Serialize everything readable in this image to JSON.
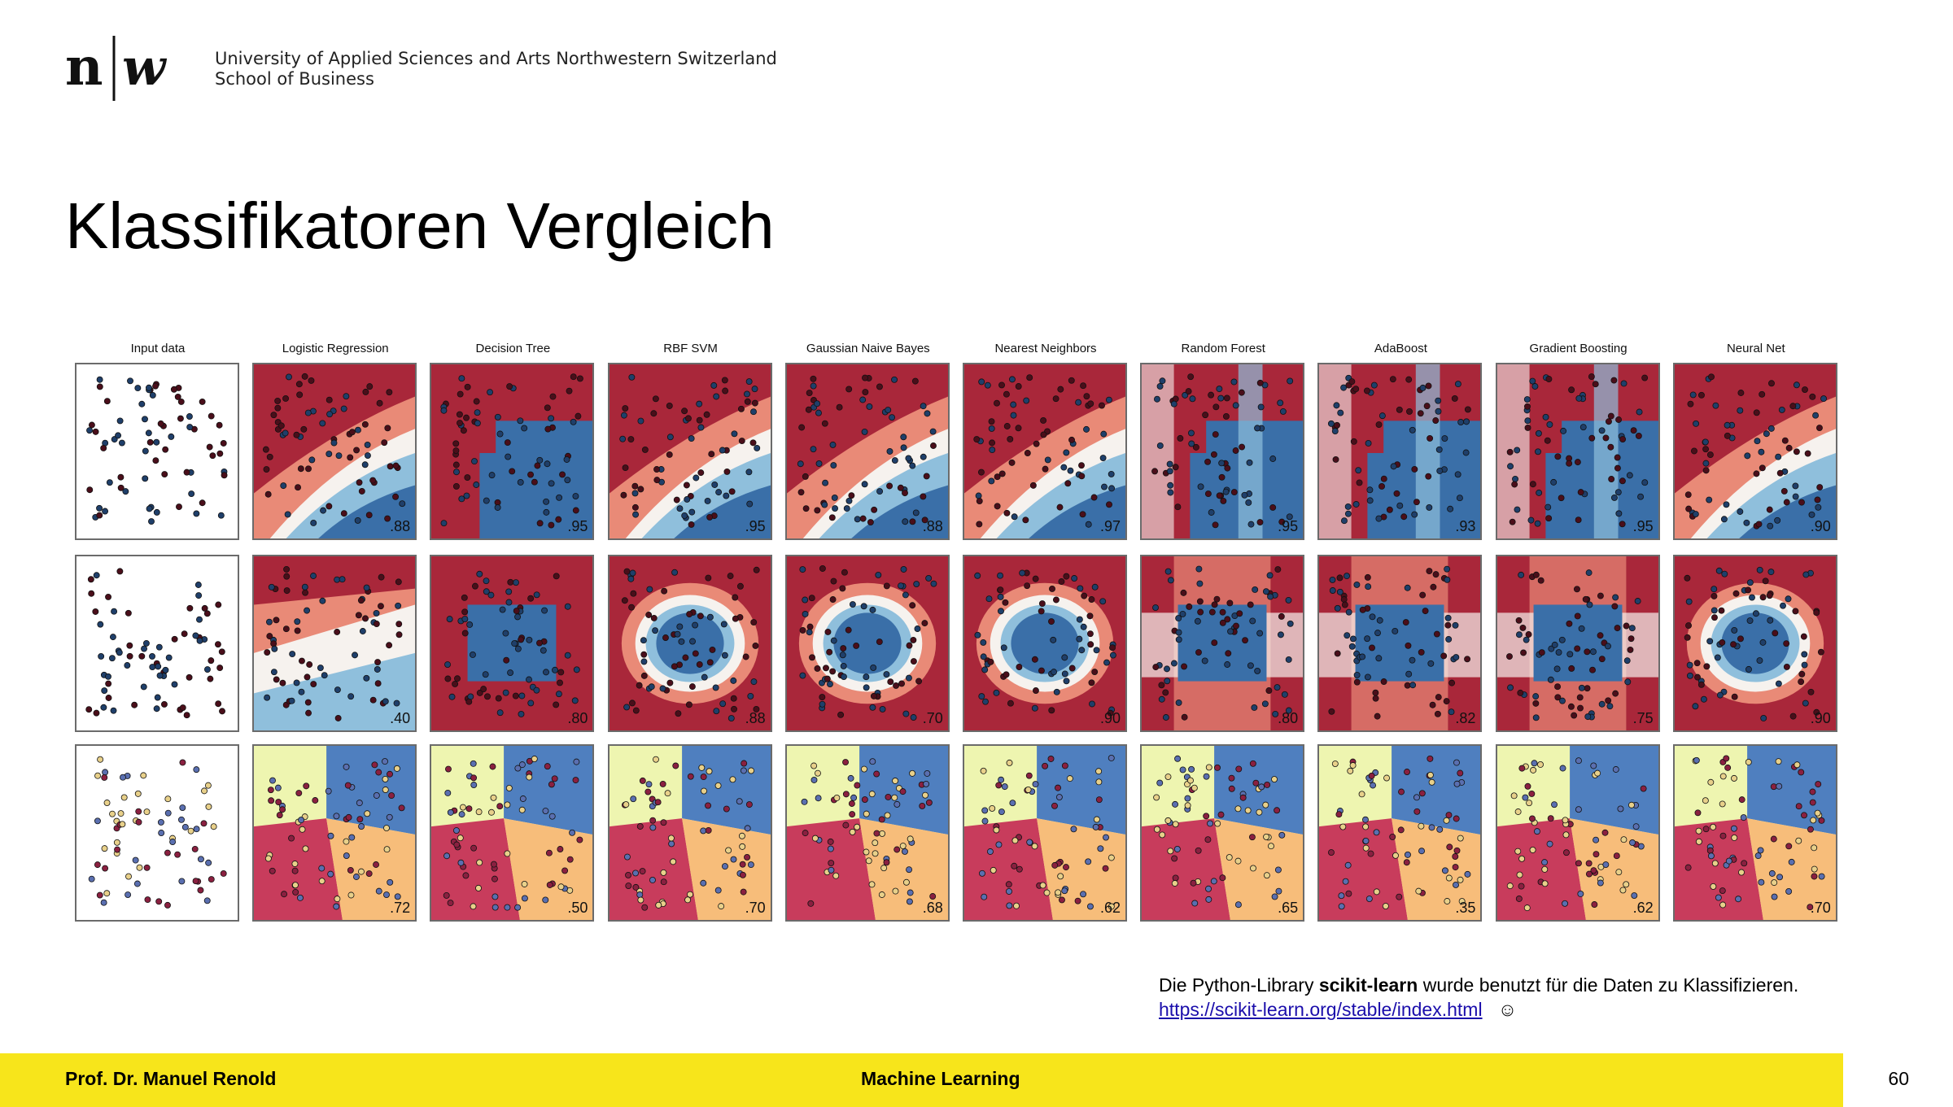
{
  "header": {
    "logo_text": "n|w",
    "institution_line1": "University of Applied Sciences and Arts Northwestern Switzerland",
    "institution_line2": "School of Business"
  },
  "slide": {
    "title": "Klassifikatoren Vergleich",
    "classifiers": [
      "Input data",
      "Logistic Regression",
      "Decision Tree",
      "RBF SVM",
      "Gaussian Naive Bayes",
      "Nearest Neighbors",
      "Random Forest",
      "AdaBoost",
      "Gradient Boosting",
      "Neural Net"
    ],
    "scores": [
      [
        "",
        ".88",
        ".95",
        ".95",
        ".88",
        ".97",
        ".95",
        ".93",
        ".95",
        ".90"
      ],
      [
        "",
        ".40",
        ".80",
        ".88",
        ".70",
        ".90",
        ".80",
        ".82",
        ".75",
        ".90"
      ],
      [
        "",
        ".72",
        ".50",
        ".70",
        ".68",
        ".62",
        ".65",
        ".35",
        ".62",
        ".70"
      ]
    ],
    "colors": {
      "red": "#a9273a",
      "light_red": "#e98a77",
      "white": "#f6f2ee",
      "light_blue": "#8fbfdc",
      "blue": "#3a6fa8",
      "yellow": "#eef5b0",
      "orange": "#f7bd7a",
      "crimson": "#c83c5c",
      "mid_blue": "#4f7fbf"
    },
    "note": {
      "prefix": "Die Python-Library ",
      "bold": "scikit-learn",
      "suffix": "  wurde benutzt für die Daten zu Klassifizieren.",
      "link": "https://scikit-learn.org/stable/index.html",
      "emoji": "☺"
    }
  },
  "footer": {
    "author": "Prof. Dr. Manuel Renold",
    "course": "Machine Learning",
    "page": "60"
  }
}
